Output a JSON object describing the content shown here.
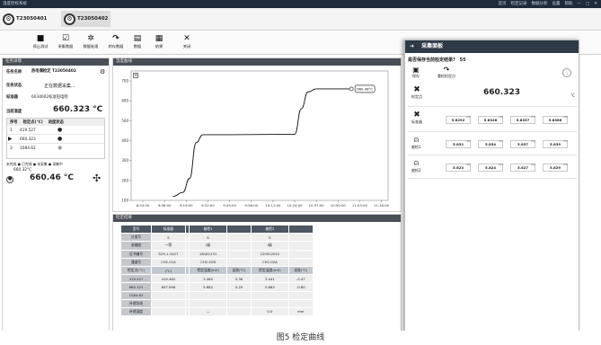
{
  "app": {
    "title": "温度检校系统",
    "window_controls": [
      "—",
      "□",
      "✕"
    ],
    "top_right_items": [
      "首页",
      "检定记录",
      "数据分析",
      "设置",
      "帮助"
    ]
  },
  "device_tabs": [
    {
      "label": "T23050401",
      "active": false
    },
    {
      "label": "T23050402",
      "active": true
    }
  ],
  "toolbar": [
    {
      "label": "停止测试",
      "icon": "stop-icon"
    },
    {
      "label": "采集数据",
      "icon": "checklist-icon"
    },
    {
      "label": "数据处理",
      "icon": "gear-icon"
    },
    {
      "label": "转存数据",
      "icon": "redo-icon"
    },
    {
      "label": "数据",
      "icon": "database-icon"
    },
    {
      "label": "结果",
      "icon": "calculator-icon"
    },
    {
      "label": "关闭",
      "icon": "close-icon"
    }
  ],
  "left_panel": {
    "header": "任务详情",
    "task_name_label": "任务名称",
    "task_name_value": "热电偶检定 T23050402",
    "task_status_label": "任务状态",
    "task_status_value": "正在数据采集...",
    "standard_label": "标准器",
    "standard_value": "6034002标准铂电阻",
    "current_temp_label": "当前温度",
    "current_temp_value": "660.323 °C",
    "table_headers": [
      "序号",
      "检定点(°C)",
      "进度状态"
    ],
    "table_rows": [
      [
        "1",
        "419.527"
      ],
      [
        "2",
        "660.323"
      ],
      [
        "3",
        "1084.62"
      ]
    ],
    "legend_text": "未完成 ● 已完成 ● 未采集 ● 采集中",
    "furnace_label": "660.32°C",
    "furnace_value": "660.46 °C"
  },
  "chart_panel": {
    "header": "温度曲线"
  },
  "chart_data": {
    "type": "line",
    "x": [
      "8:53:00",
      "9:06:00",
      "9:19:00",
      "9:32:00",
      "9:45:00",
      "9:58:00",
      "10:11:00",
      "10:24:00",
      "10:37:00",
      "10:50:00",
      "11:03:00",
      "11:16:00"
    ],
    "y_ticks": [
      100,
      200,
      300,
      400,
      500,
      600,
      700
    ],
    "ylim": [
      100,
      750
    ],
    "series": [
      {
        "values": [
          {
            "x": "9:11:00",
            "y": 120
          },
          {
            "x": "9:17:00",
            "y": 140
          },
          {
            "x": "9:21:00",
            "y": 210
          },
          {
            "x": "9:25:00",
            "y": 390
          },
          {
            "x": "9:29:00",
            "y": 430
          },
          {
            "x": "9:45:00",
            "y": 430
          },
          {
            "x": "10:24:00",
            "y": 432
          },
          {
            "x": "10:28:00",
            "y": 560
          },
          {
            "x": "10:32:00",
            "y": 645
          },
          {
            "x": "10:37:00",
            "y": 660
          },
          {
            "x": "10:58:00",
            "y": 660
          }
        ]
      }
    ],
    "annotation": "660.48°C",
    "grid": false
  },
  "table_panel": {
    "header": "检定结果",
    "rows": [
      [
        "型号",
        "标准器",
        "",
        "被检1",
        "",
        "被检2",
        ""
      ],
      [
        "分度号",
        "S",
        "",
        "S",
        "",
        "S",
        ""
      ],
      [
        "准确度",
        "一等",
        "",
        "I级",
        "",
        "I级",
        ""
      ],
      [
        "证书编号",
        "S29-1-3427",
        "",
        "18181231",
        "",
        "220912022",
        ""
      ],
      [
        "通道号",
        "CH2-01A",
        "",
        "CH2-02B",
        "",
        "CH2-02A",
        ""
      ],
      [
        "检定点(°C)",
        "(°C)",
        "",
        "检定温度(mV)",
        "误差(°C)",
        "检定温度(mV)",
        "误差(°C)"
      ],
      [
        "419.527",
        "419.482",
        "",
        "3.460",
        "0.36",
        "3.441",
        "-0.47"
      ],
      [
        "660.323",
        "657.998",
        "",
        "5.882",
        "0.20",
        "5.882",
        "-0.80"
      ],
      [
        "1084.62",
        "",
        "",
        "",
        "",
        "",
        ""
      ],
      [
        "补偿导线",
        "",
        "",
        "",
        "",
        "",
        ""
      ],
      [
        "补偿温度",
        "",
        "",
        "—",
        "",
        "0.0",
        "mm"
      ]
    ]
  },
  "right_panel": {
    "header": "采集面板",
    "question": "是否保存当前检定结果?",
    "countdown": "55",
    "save_label": "保存",
    "resample_label": "重检检定点",
    "checkpoint_label": "检定点",
    "checkpoint_value": "660.323",
    "checkpoint_unit": "°C",
    "std_label": "标准器",
    "std_values": [
      "5.8292",
      "5.8328",
      "5.8357",
      "5.8366"
    ],
    "dut1_label": "被检1",
    "dut1_values": [
      "5.832",
      "5.834",
      "5.837",
      "5.839"
    ],
    "dut2_label": "被检2",
    "dut2_values": [
      "5.823",
      "5.824",
      "5.827",
      "5.829"
    ],
    "unit": "mV"
  },
  "caption": "图5 检定曲线"
}
